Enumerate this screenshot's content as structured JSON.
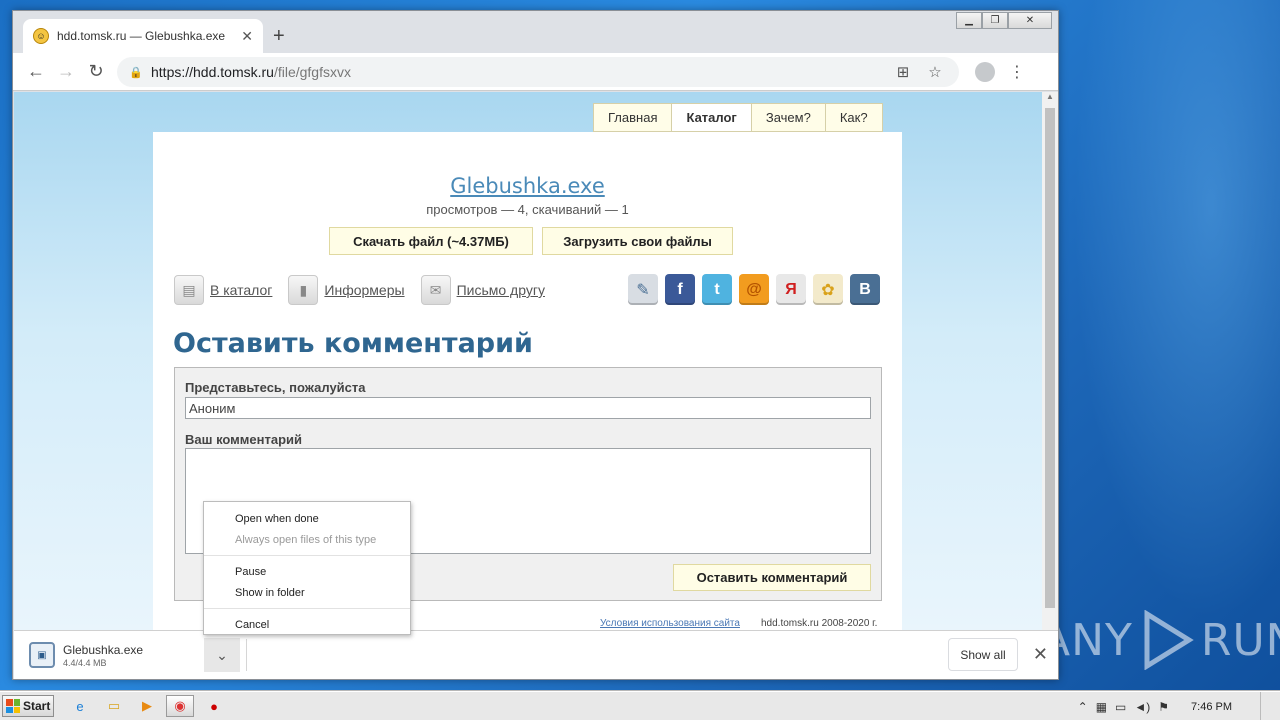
{
  "browser": {
    "tab_title": "hdd.tomsk.ru — Glebushka.exe",
    "url_host": "https://hdd.tomsk.ru",
    "url_path": "/file/gfgfsxvx",
    "new_tab": "+"
  },
  "site_nav": [
    "Главная",
    "Каталог",
    "Зачем?",
    "Как?"
  ],
  "file": {
    "title": "Glebushka.exe",
    "stats": "просмотров — 4, скачиваний — 1",
    "download_label": "Скачать файл (~4.37МБ)",
    "upload_label": "Загрузить свои файлы"
  },
  "links": [
    {
      "label": "В каталог",
      "icon": "catalog-icon"
    },
    {
      "label": "Информеры",
      "icon": "chart-icon"
    },
    {
      "label": "Письмо другу",
      "icon": "mail-icon"
    }
  ],
  "social": [
    {
      "name": "livejournal",
      "glyph": "✎",
      "color": "#d8dde3"
    },
    {
      "name": "facebook",
      "glyph": "f",
      "color": "#3b5998"
    },
    {
      "name": "twitter",
      "glyph": "t",
      "color": "#4fb3e0"
    },
    {
      "name": "mailru",
      "glyph": "@",
      "color": "#f29c1f"
    },
    {
      "name": "yandex",
      "glyph": "Я",
      "color": "#e8e8e8"
    },
    {
      "name": "odnoklassniki",
      "glyph": "✿",
      "color": "#f3eacb"
    },
    {
      "name": "vkontakte",
      "glyph": "B",
      "color": "#4a6f94"
    }
  ],
  "comment": {
    "heading": "Оставить комментарий",
    "name_label": "Представьтесь, пожалуйста",
    "name_value": "Аноним",
    "comment_label": "Ваш комментарий",
    "submit_label": "Оставить комментарий"
  },
  "footer": {
    "terms": "Условия использования сайта",
    "copyright": "hdd.tomsk.ru 2008-2020 г."
  },
  "download_bar": {
    "filename": "Glebushka.exe",
    "progress": "4.4/4.4 MB",
    "show_all": "Show all"
  },
  "context_menu": {
    "open_when_done": "Open when done",
    "always_open": "Always open files of this type",
    "pause": "Pause",
    "show_in_folder": "Show in folder",
    "cancel": "Cancel"
  },
  "taskbar": {
    "start": "Start",
    "clock": "7:46 PM"
  },
  "watermark": "ANY RUN"
}
